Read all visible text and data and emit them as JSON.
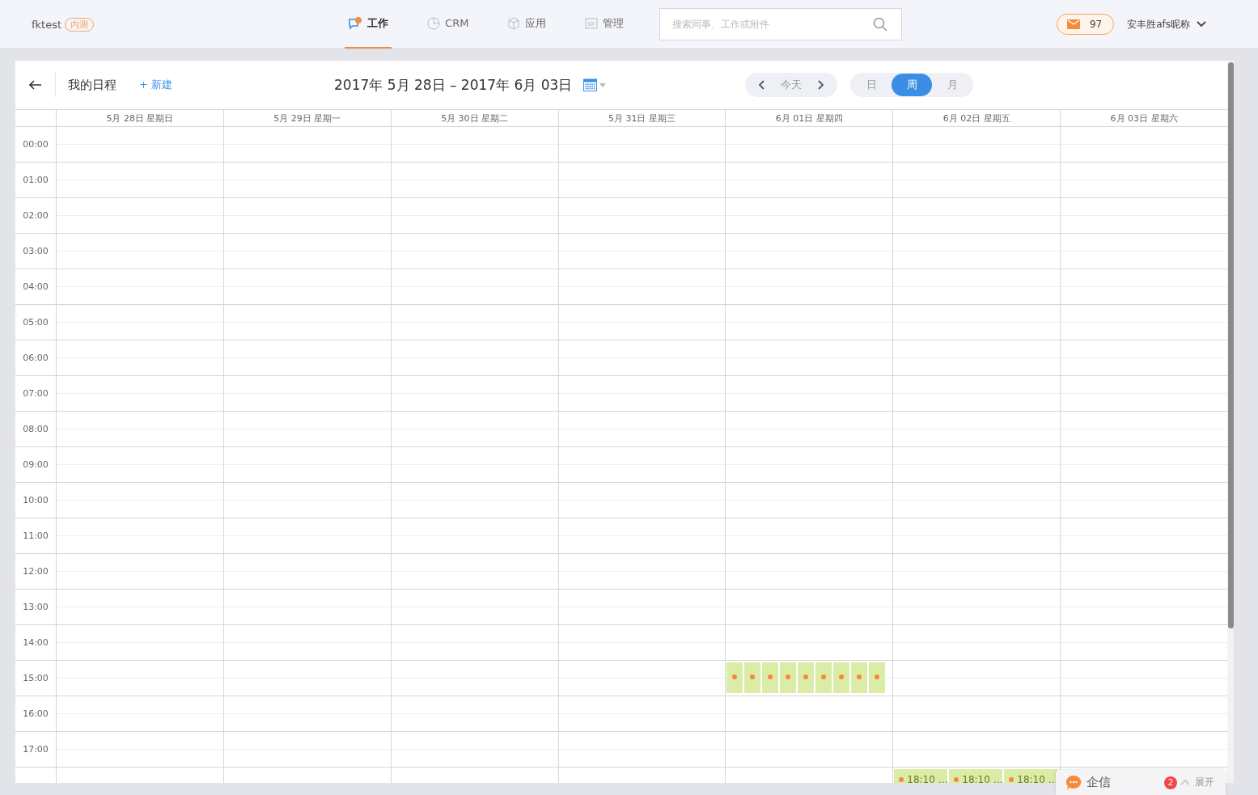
{
  "brand": {
    "name": "fktest",
    "badge": "内测"
  },
  "nav": [
    {
      "label": "工作",
      "selected": true
    },
    {
      "label": "CRM",
      "selected": false
    },
    {
      "label": "应用",
      "selected": false
    },
    {
      "label": "管理",
      "selected": false
    }
  ],
  "search": {
    "placeholder": "搜索同事、工作或附件"
  },
  "mail": {
    "count": "97"
  },
  "user": {
    "name": "安丰胜afs昵称"
  },
  "toolbar": {
    "title": "我的日程",
    "new_label": "+ 新建",
    "range": "2017年 5月 28日 – 2017年 6月 03日",
    "today": "今天",
    "views": [
      {
        "label": "日",
        "selected": false
      },
      {
        "label": "周",
        "selected": true
      },
      {
        "label": "月",
        "selected": false
      }
    ]
  },
  "days": [
    "5月 28日 星期日",
    "5月 29日 星期一",
    "5月 30日 星期二",
    "5月 31日 星期三",
    "6月 01日 星期四",
    "6月 02日 星期五",
    "6月 03日 星期六"
  ],
  "rows": [
    {
      "time": "00:00"
    },
    {
      "time": "01:00"
    },
    {
      "time": "02:00"
    },
    {
      "time": "03:00"
    },
    {
      "time": "04:00"
    },
    {
      "time": "05:00"
    },
    {
      "time": "06:00"
    },
    {
      "time": "07:00"
    },
    {
      "time": "08:00"
    },
    {
      "time": "09:00"
    },
    {
      "time": "10:00"
    },
    {
      "time": "11:00"
    },
    {
      "time": "12:00"
    },
    {
      "time": "13:00"
    },
    {
      "time": "14:00"
    },
    {
      "time": "15:00",
      "cells": [
        {},
        {},
        {},
        {},
        {
          "events": [
            {
              "kind": "dot"
            },
            {
              "kind": "dot"
            },
            {
              "kind": "dot"
            },
            {
              "kind": "dot"
            },
            {
              "kind": "dot"
            },
            {
              "kind": "dot"
            },
            {
              "kind": "dot"
            },
            {
              "kind": "dot"
            },
            {
              "kind": "dot"
            }
          ]
        },
        {},
        {}
      ]
    },
    {
      "time": "16:00"
    },
    {
      "time": "17:00"
    },
    {
      "cells": [
        {},
        {},
        {},
        {},
        {},
        {
          "events": [
            {
              "kind": "labeled",
              "label": "18:10 …"
            },
            {
              "kind": "labeled",
              "label": "18:10 …"
            },
            {
              "kind": "labeled",
              "label": "18:10 …"
            }
          ]
        },
        {}
      ]
    }
  ],
  "chat": {
    "title": "企信",
    "unread": "2",
    "action": "展开"
  }
}
